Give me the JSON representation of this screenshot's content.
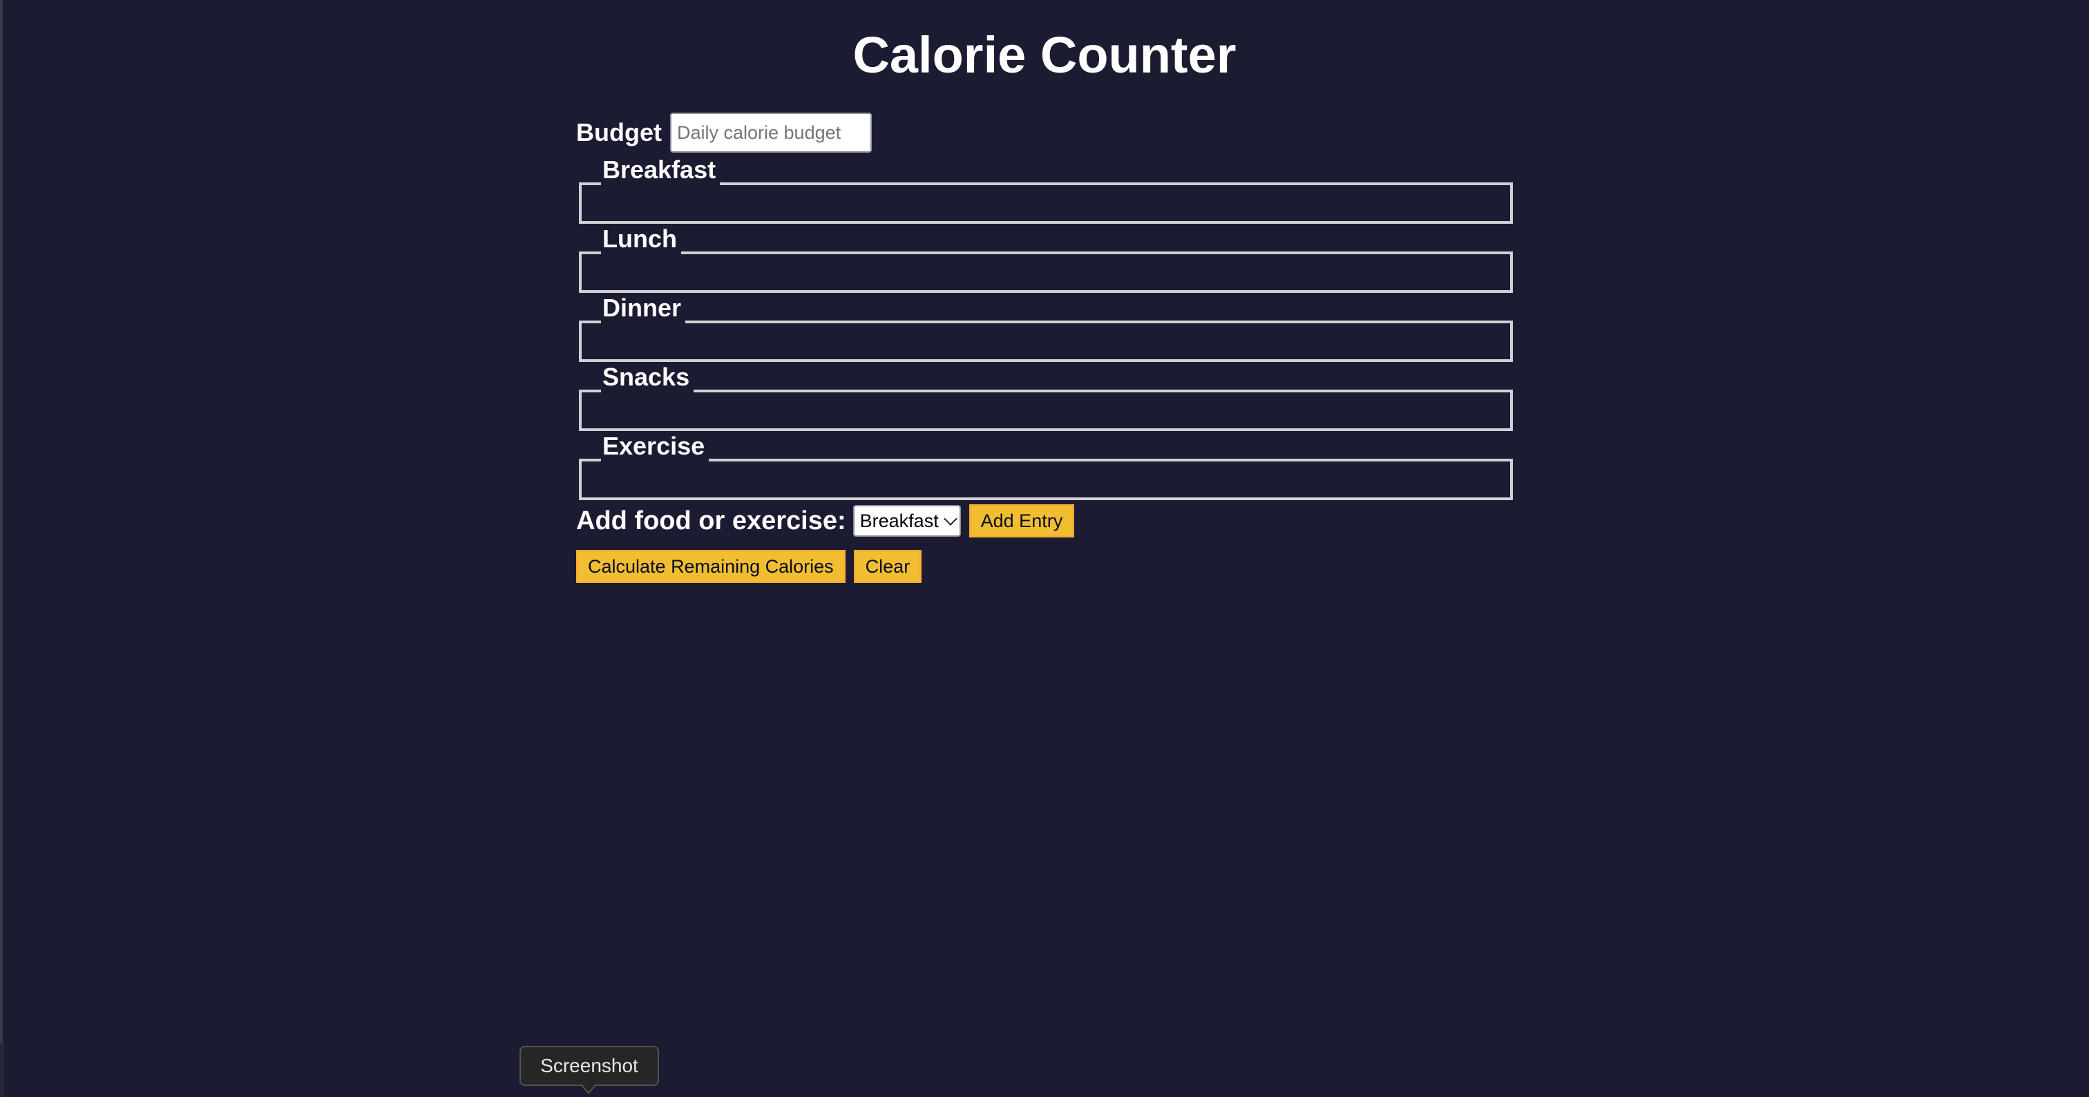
{
  "page": {
    "title": "Calorie Counter",
    "background": "#1b1b32",
    "accent": "#f1be32"
  },
  "budget": {
    "label": "Budget",
    "placeholder": "Daily calorie budget",
    "value": ""
  },
  "sections": [
    {
      "legend": "Breakfast"
    },
    {
      "legend": "Lunch"
    },
    {
      "legend": "Dinner"
    },
    {
      "legend": "Snacks"
    },
    {
      "legend": "Exercise"
    }
  ],
  "add_entry": {
    "label": "Add food or exercise:",
    "selected": "Breakfast",
    "button": "Add Entry"
  },
  "actions": {
    "calculate": "Calculate Remaining Calories",
    "clear": "Clear"
  },
  "tooltip": {
    "text": "Screenshot"
  }
}
